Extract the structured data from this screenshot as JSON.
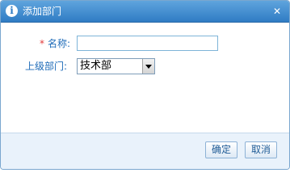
{
  "dialog": {
    "title": "添加部门",
    "close_glyph": "✕",
    "title_icon": "i"
  },
  "form": {
    "name_required_mark": "*",
    "name_label": "名称:",
    "name_value": "",
    "department_label": "上级部门:",
    "department_selected": "技术部"
  },
  "buttons": {
    "ok_label": "确定",
    "cancel_label": "取消"
  },
  "colors": {
    "titlebar": "#2f7cc4",
    "label": "#1e6bb8",
    "required": "#e23b3b",
    "footer": "#e9f2fb"
  }
}
